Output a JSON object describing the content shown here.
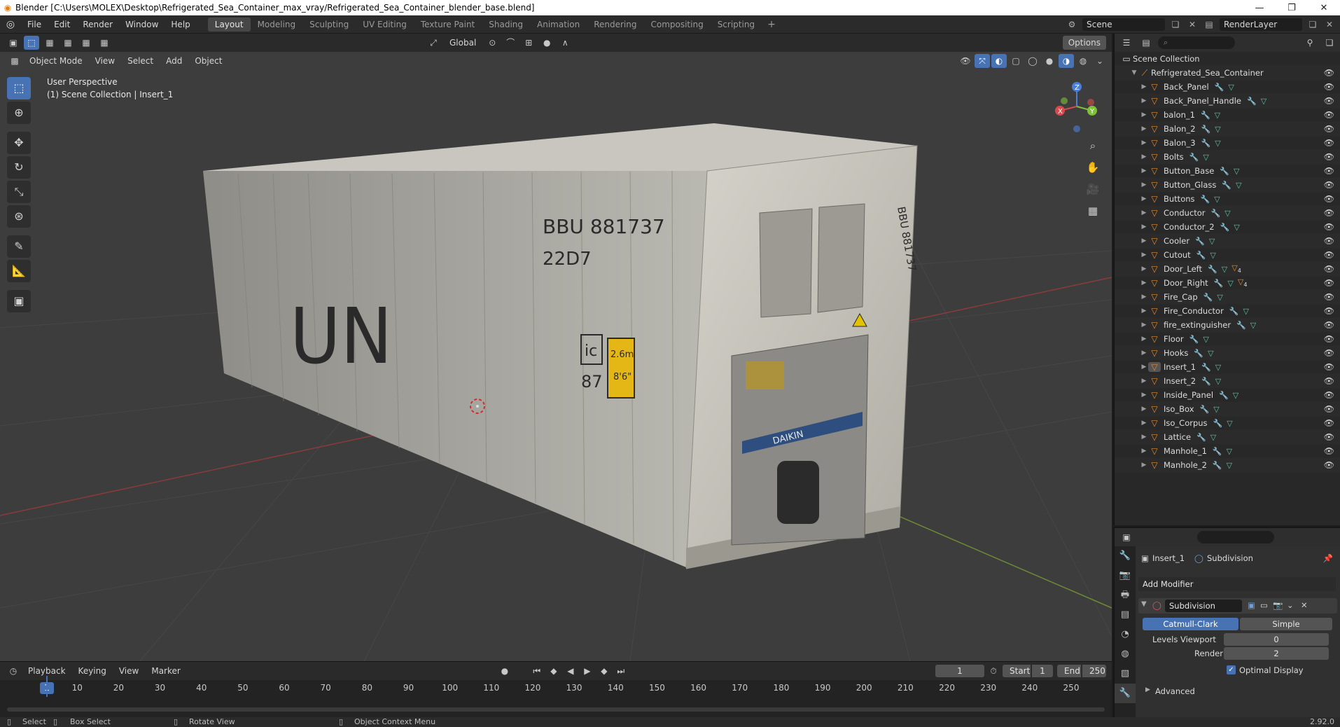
{
  "window": {
    "title": "Blender [C:\\Users\\MOLEX\\Desktop\\Refrigerated_Sea_Container_max_vray/Refrigerated_Sea_Container_blender_base.blend]"
  },
  "menu": [
    "File",
    "Edit",
    "Render",
    "Window",
    "Help"
  ],
  "workspaces": [
    "Layout",
    "Modeling",
    "Sculpting",
    "UV Editing",
    "Texture Paint",
    "Shading",
    "Animation",
    "Rendering",
    "Compositing",
    "Scripting"
  ],
  "active_workspace": "Layout",
  "topright": {
    "scene": "Scene",
    "render_layer": "RenderLayer"
  },
  "viewport": {
    "mode": "Object Mode",
    "menus": [
      "View",
      "Select",
      "Add",
      "Object"
    ],
    "transform_orientation": "Global",
    "options_label": "Options",
    "overlay_line1": "User Perspective",
    "overlay_line2": "(1) Scene Collection | Insert_1"
  },
  "container_markings": {
    "side_text": "UN",
    "code_line1": "BBU 881737",
    "code_line2": "22D7",
    "ic_label": "ic",
    "ic_number": "87",
    "height_label": "2.6m",
    "height_ft": "8'6\"",
    "end_code": "BBU 881737",
    "brand": "DAIKIN"
  },
  "timeline": {
    "menus": [
      "Playback",
      "Keying",
      "View",
      "Marker"
    ],
    "current_frame": "1",
    "start_label": "Start",
    "start": "1",
    "end_label": "End",
    "end": "250",
    "ticks": [
      "10",
      "20",
      "30",
      "40",
      "50",
      "60",
      "70",
      "80",
      "90",
      "100",
      "110",
      "120",
      "130",
      "140",
      "150",
      "160",
      "170",
      "180",
      "190",
      "200",
      "210",
      "220",
      "230",
      "240",
      "250"
    ],
    "playhead": "1"
  },
  "outliner": {
    "root": "Scene Collection",
    "collection": "Refrigerated_Sea_Container",
    "objects": [
      {
        "name": "Back_Panel"
      },
      {
        "name": "Back_Panel_Handle"
      },
      {
        "name": "balon_1"
      },
      {
        "name": "Balon_2"
      },
      {
        "name": "Balon_3"
      },
      {
        "name": "Bolts"
      },
      {
        "name": "Button_Base"
      },
      {
        "name": "Button_Glass"
      },
      {
        "name": "Buttons"
      },
      {
        "name": "Conductor"
      },
      {
        "name": "Conductor_2"
      },
      {
        "name": "Cooler"
      },
      {
        "name": "Cutout"
      },
      {
        "name": "Door_Left",
        "materials": "4"
      },
      {
        "name": "Door_Right",
        "materials": "4"
      },
      {
        "name": "Fire_Cap"
      },
      {
        "name": "Fire_Conductor"
      },
      {
        "name": "fire_extinguisher"
      },
      {
        "name": "Floor"
      },
      {
        "name": "Hooks"
      },
      {
        "name": "Insert_1",
        "selected": true
      },
      {
        "name": "Insert_2"
      },
      {
        "name": "Inside_Panel"
      },
      {
        "name": "Iso_Box"
      },
      {
        "name": "Iso_Corpus"
      },
      {
        "name": "Lattice"
      },
      {
        "name": "Manhole_1"
      },
      {
        "name": "Manhole_2"
      }
    ]
  },
  "properties": {
    "object_name": "Insert_1",
    "modifier_context": "Subdivision",
    "add_modifier": "Add Modifier",
    "modifier_name": "Subdivision",
    "mode_catmull": "Catmull-Clark",
    "mode_simple": "Simple",
    "levels_viewport_label": "Levels Viewport",
    "levels_viewport": "0",
    "render_label": "Render",
    "render": "2",
    "optimal_display": "Optimal Display",
    "advanced": "Advanced"
  },
  "status": {
    "select": "Select",
    "box_select": "Box Select",
    "rotate_view": "Rotate View",
    "context_menu": "Object Context Menu",
    "version": "2.92.0"
  },
  "colors": {
    "accent": "#4772b3",
    "object_icon": "#e88a2c",
    "mesh_icon": "#52c9a1",
    "modifier_icon": "#6aa0e0"
  }
}
